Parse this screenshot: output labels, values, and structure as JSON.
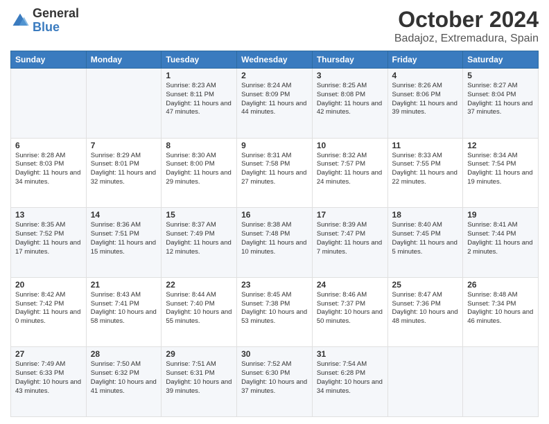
{
  "header": {
    "logo_general": "General",
    "logo_blue": "Blue",
    "title": "October 2024",
    "subtitle": "Badajoz, Extremadura, Spain"
  },
  "days_of_week": [
    "Sunday",
    "Monday",
    "Tuesday",
    "Wednesday",
    "Thursday",
    "Friday",
    "Saturday"
  ],
  "weeks": [
    [
      {
        "day": "",
        "content": ""
      },
      {
        "day": "",
        "content": ""
      },
      {
        "day": "1",
        "content": "Sunrise: 8:23 AM\nSunset: 8:11 PM\nDaylight: 11 hours and 47 minutes."
      },
      {
        "day": "2",
        "content": "Sunrise: 8:24 AM\nSunset: 8:09 PM\nDaylight: 11 hours and 44 minutes."
      },
      {
        "day": "3",
        "content": "Sunrise: 8:25 AM\nSunset: 8:08 PM\nDaylight: 11 hours and 42 minutes."
      },
      {
        "day": "4",
        "content": "Sunrise: 8:26 AM\nSunset: 8:06 PM\nDaylight: 11 hours and 39 minutes."
      },
      {
        "day": "5",
        "content": "Sunrise: 8:27 AM\nSunset: 8:04 PM\nDaylight: 11 hours and 37 minutes."
      }
    ],
    [
      {
        "day": "6",
        "content": "Sunrise: 8:28 AM\nSunset: 8:03 PM\nDaylight: 11 hours and 34 minutes."
      },
      {
        "day": "7",
        "content": "Sunrise: 8:29 AM\nSunset: 8:01 PM\nDaylight: 11 hours and 32 minutes."
      },
      {
        "day": "8",
        "content": "Sunrise: 8:30 AM\nSunset: 8:00 PM\nDaylight: 11 hours and 29 minutes."
      },
      {
        "day": "9",
        "content": "Sunrise: 8:31 AM\nSunset: 7:58 PM\nDaylight: 11 hours and 27 minutes."
      },
      {
        "day": "10",
        "content": "Sunrise: 8:32 AM\nSunset: 7:57 PM\nDaylight: 11 hours and 24 minutes."
      },
      {
        "day": "11",
        "content": "Sunrise: 8:33 AM\nSunset: 7:55 PM\nDaylight: 11 hours and 22 minutes."
      },
      {
        "day": "12",
        "content": "Sunrise: 8:34 AM\nSunset: 7:54 PM\nDaylight: 11 hours and 19 minutes."
      }
    ],
    [
      {
        "day": "13",
        "content": "Sunrise: 8:35 AM\nSunset: 7:52 PM\nDaylight: 11 hours and 17 minutes."
      },
      {
        "day": "14",
        "content": "Sunrise: 8:36 AM\nSunset: 7:51 PM\nDaylight: 11 hours and 15 minutes."
      },
      {
        "day": "15",
        "content": "Sunrise: 8:37 AM\nSunset: 7:49 PM\nDaylight: 11 hours and 12 minutes."
      },
      {
        "day": "16",
        "content": "Sunrise: 8:38 AM\nSunset: 7:48 PM\nDaylight: 11 hours and 10 minutes."
      },
      {
        "day": "17",
        "content": "Sunrise: 8:39 AM\nSunset: 7:47 PM\nDaylight: 11 hours and 7 minutes."
      },
      {
        "day": "18",
        "content": "Sunrise: 8:40 AM\nSunset: 7:45 PM\nDaylight: 11 hours and 5 minutes."
      },
      {
        "day": "19",
        "content": "Sunrise: 8:41 AM\nSunset: 7:44 PM\nDaylight: 11 hours and 2 minutes."
      }
    ],
    [
      {
        "day": "20",
        "content": "Sunrise: 8:42 AM\nSunset: 7:42 PM\nDaylight: 11 hours and 0 minutes."
      },
      {
        "day": "21",
        "content": "Sunrise: 8:43 AM\nSunset: 7:41 PM\nDaylight: 10 hours and 58 minutes."
      },
      {
        "day": "22",
        "content": "Sunrise: 8:44 AM\nSunset: 7:40 PM\nDaylight: 10 hours and 55 minutes."
      },
      {
        "day": "23",
        "content": "Sunrise: 8:45 AM\nSunset: 7:38 PM\nDaylight: 10 hours and 53 minutes."
      },
      {
        "day": "24",
        "content": "Sunrise: 8:46 AM\nSunset: 7:37 PM\nDaylight: 10 hours and 50 minutes."
      },
      {
        "day": "25",
        "content": "Sunrise: 8:47 AM\nSunset: 7:36 PM\nDaylight: 10 hours and 48 minutes."
      },
      {
        "day": "26",
        "content": "Sunrise: 8:48 AM\nSunset: 7:34 PM\nDaylight: 10 hours and 46 minutes."
      }
    ],
    [
      {
        "day": "27",
        "content": "Sunrise: 7:49 AM\nSunset: 6:33 PM\nDaylight: 10 hours and 43 minutes."
      },
      {
        "day": "28",
        "content": "Sunrise: 7:50 AM\nSunset: 6:32 PM\nDaylight: 10 hours and 41 minutes."
      },
      {
        "day": "29",
        "content": "Sunrise: 7:51 AM\nSunset: 6:31 PM\nDaylight: 10 hours and 39 minutes."
      },
      {
        "day": "30",
        "content": "Sunrise: 7:52 AM\nSunset: 6:30 PM\nDaylight: 10 hours and 37 minutes."
      },
      {
        "day": "31",
        "content": "Sunrise: 7:54 AM\nSunset: 6:28 PM\nDaylight: 10 hours and 34 minutes."
      },
      {
        "day": "",
        "content": ""
      },
      {
        "day": "",
        "content": ""
      }
    ]
  ]
}
